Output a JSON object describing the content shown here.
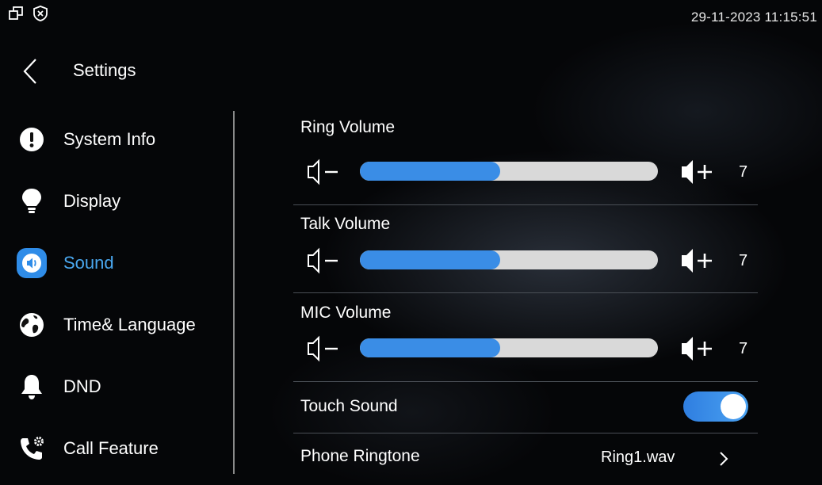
{
  "status_bar": {
    "datetime": "29-11-2023 11:15:51",
    "icons": [
      "multi-window-icon",
      "shield-x-icon"
    ]
  },
  "header": {
    "back_icon": "chevron-left-icon",
    "title": "Settings"
  },
  "sidebar": {
    "items": [
      {
        "label": "System Info",
        "icon": "info-exclamation-icon",
        "active": false
      },
      {
        "label": "Display",
        "icon": "lightbulb-icon",
        "active": false
      },
      {
        "label": "Sound",
        "icon": "speaker-icon",
        "active": true
      },
      {
        "label": "Time& Language",
        "icon": "globe-icon",
        "active": false
      },
      {
        "label": "DND",
        "icon": "bell-icon",
        "active": false
      },
      {
        "label": "Call Feature",
        "icon": "phone-gear-icon",
        "active": false
      }
    ]
  },
  "colors": {
    "accent": "#3a8de6",
    "active_text": "#4aa8f0",
    "track": "#d9d9d9",
    "background": "#050608"
  },
  "sound": {
    "ring_volume": {
      "label": "Ring Volume",
      "value": "7",
      "fill_fraction": 0.47
    },
    "talk_volume": {
      "label": "Talk Volume",
      "value": "7",
      "fill_fraction": 0.47
    },
    "mic_volume": {
      "label": "MIC Volume",
      "value": "7",
      "fill_fraction": 0.47
    },
    "touch_sound": {
      "label": "Touch Sound",
      "enabled": true
    },
    "phone_ringtone": {
      "label": "Phone Ringtone",
      "value": "Ring1.wav"
    }
  }
}
